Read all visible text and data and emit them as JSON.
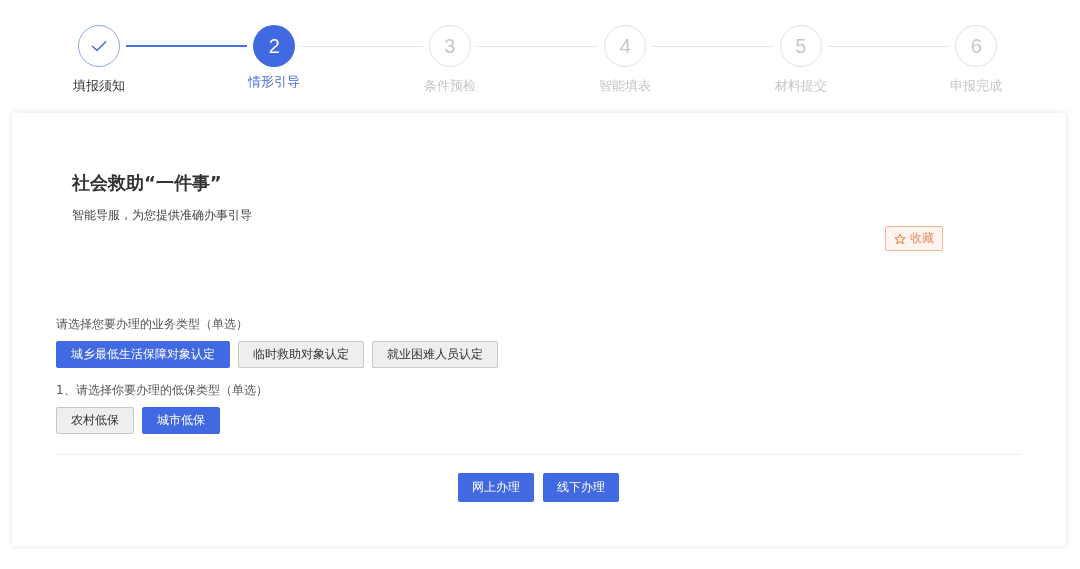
{
  "steps": [
    {
      "label": "填报须知",
      "done": true,
      "selected": false
    },
    {
      "number": "2",
      "label": "情形引导",
      "done": false,
      "selected": true
    },
    {
      "number": "3",
      "label": "条件预检",
      "done": false,
      "selected": false
    },
    {
      "number": "4",
      "label": "智能填表",
      "done": false,
      "selected": false
    },
    {
      "number": "5",
      "label": "材料提交",
      "done": false,
      "selected": false
    },
    {
      "number": "6",
      "label": "申报完成",
      "done": false,
      "selected": false
    }
  ],
  "card": {
    "title": "社会救助“一件事”",
    "subtitle": "智能导服，为您提供准确办事引导",
    "favorite_button": "收藏",
    "questions": [
      {
        "label": "请选择您要办理的业务类型（单选）",
        "options": [
          {
            "label": "城乡最低生活保障对象认定",
            "selected": true
          },
          {
            "label": "临时救助对象认定",
            "selected": false
          },
          {
            "label": "就业困难人员认定",
            "selected": false
          }
        ]
      },
      {
        "label": "1、请选择你要办理的低保类型（单选）",
        "options": [
          {
            "label": "农村低保",
            "selected": false
          },
          {
            "label": "城市低保",
            "selected": true
          }
        ]
      }
    ],
    "actions": [
      "网上办理",
      "线下办理"
    ]
  }
}
